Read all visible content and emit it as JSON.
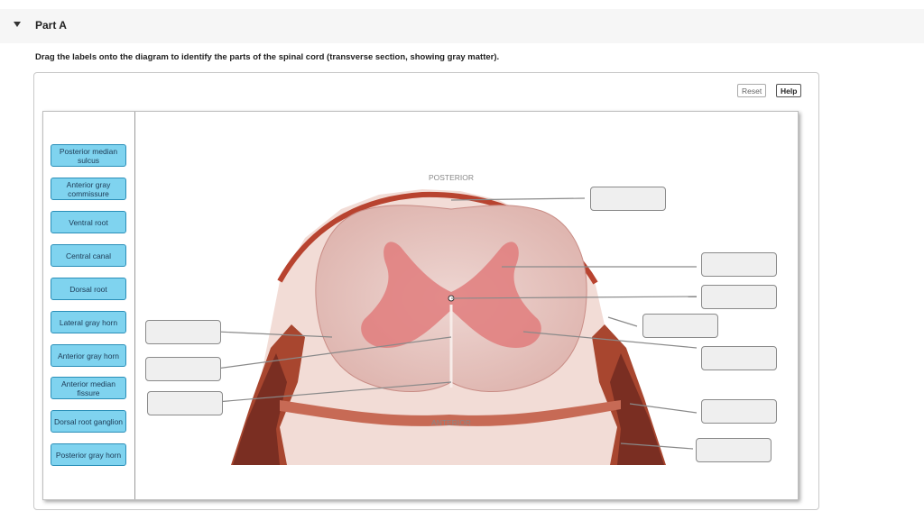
{
  "part": {
    "title": "Part A"
  },
  "instructions": "Drag the labels onto the diagram to identify the parts of the spinal cord (transverse section, showing gray matter).",
  "toolbar": {
    "reset_label": "Reset",
    "help_label": "Help"
  },
  "labels": [
    "Posterior median sulcus",
    "Anterior gray commissure",
    "Ventral root",
    "Central canal",
    "Dorsal root",
    "Lateral gray horn",
    "Anterior gray horn",
    "Anterior median fissure",
    "Dorsal root ganglion",
    "Posterior gray horn"
  ],
  "diagram": {
    "posterior_text": "POSTERIOR",
    "anterior_text": "ANTERIOR"
  },
  "colors": {
    "label_fill": "#7fd3ef",
    "label_border": "#2a8fb8",
    "drop_target_fill": "#efefef",
    "white_matter": "#e7c7c2",
    "gray_matter": "#e37f7f",
    "tissue": "#c0503e"
  }
}
